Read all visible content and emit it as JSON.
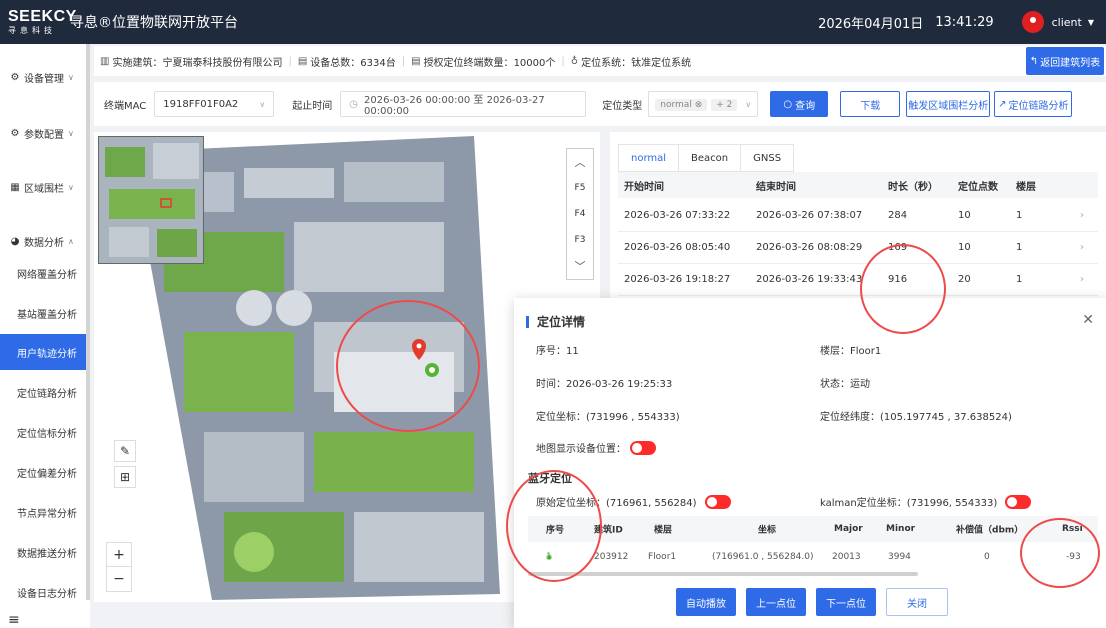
{
  "topbar": {
    "logo_main": "SEEKCY",
    "logo_sub": "寻息科技",
    "title": "寻息®位置物联网开放平台",
    "date": "2026年04月01日",
    "time": "13:41:29",
    "user": "client"
  },
  "sidebar": {
    "groups": [
      {
        "label": "设备管理",
        "icon": "gear-icon"
      },
      {
        "label": "参数配置",
        "icon": "sliders-icon"
      },
      {
        "label": "区域围栏",
        "icon": "fence-icon"
      },
      {
        "label": "数据分析",
        "icon": "pie-chart-icon"
      }
    ],
    "items": [
      "网络覆盖分析",
      "基站覆盖分析",
      "用户轨迹分析",
      "定位链路分析",
      "定位信标分析",
      "定位偏差分析",
      "节点异常分析",
      "数据推送分析",
      "设备日志分析"
    ],
    "active_index": 2
  },
  "infobar": {
    "building_label": "实施建筑：",
    "building": "宁夏瑞泰科技股份有限公司",
    "device_label": "设备总数：",
    "device_count": "6334台",
    "auth_label": "授权定位终端数量：",
    "auth_count": "10000个",
    "system_label": "定位系统：",
    "system": "钛准定位系统",
    "back_button": "返回建筑列表"
  },
  "filter": {
    "mac_label": "终端MAC",
    "mac_value": "1918FF01F0A2",
    "time_label": "起止时间",
    "time_range": "2026-03-26 00:00:00 至 2026-03-27 00:00:00",
    "type_label": "定位类型",
    "type_tag": "normal",
    "type_more": "+ 2",
    "query_button": "查询",
    "download_button": "下载",
    "fence_button": "触发区域围栏分析",
    "link_button": "定位链路分析"
  },
  "floors": {
    "items": [
      "F5",
      "F4",
      "F3"
    ]
  },
  "track": {
    "tabs": [
      "normal",
      "Beacon",
      "GNSS"
    ],
    "active_tab": 0,
    "columns": [
      "开始时间",
      "结束时间",
      "时长（秒）",
      "定位点数",
      "楼层"
    ],
    "rows": [
      [
        "2026-03-26 07:33:22",
        "2026-03-26 07:38:07",
        "284",
        "10",
        "1"
      ],
      [
        "2026-03-26 08:05:40",
        "2026-03-26 08:08:29",
        "169",
        "10",
        "1"
      ],
      [
        "2026-03-26 19:18:27",
        "2026-03-26 19:33:43",
        "916",
        "20",
        "1"
      ]
    ]
  },
  "detail": {
    "title": "定位详情",
    "seq": "序号：11",
    "floor": "楼层：Floor1",
    "time": "时间：2026-03-26 19:25:33",
    "status": "状态：运动",
    "coord": "定位坐标：(731996 , 554333)",
    "lnglat": "定位经纬度：(105.197745 , 37.638524)",
    "show_device": "地图显示设备位置：",
    "bt_title": "蓝牙定位",
    "raw_coord": "原始定位坐标：(716961, 556284)",
    "kalman_coord": "kalman定位坐标：(731996, 554333)",
    "bt_columns": [
      "序号",
      "建筑ID",
      "楼层",
      "坐标",
      "Major",
      "Minor",
      "补偿值（dbm）",
      "Rssi"
    ],
    "bt_rows": [
      [
        "1",
        "203912",
        "Floor1",
        "(716961.0 , 556284.0)",
        "20013",
        "3994",
        "0",
        "-93"
      ]
    ],
    "buttons": {
      "autoplay": "自动播放",
      "prev": "上一点位",
      "next": "下一点位",
      "close": "关闭"
    }
  },
  "colors": {
    "primary": "#2f6be6",
    "topbar": "#1f2a3d",
    "toggle": "#ff2a2a",
    "annotation": "#ee4a4a"
  }
}
